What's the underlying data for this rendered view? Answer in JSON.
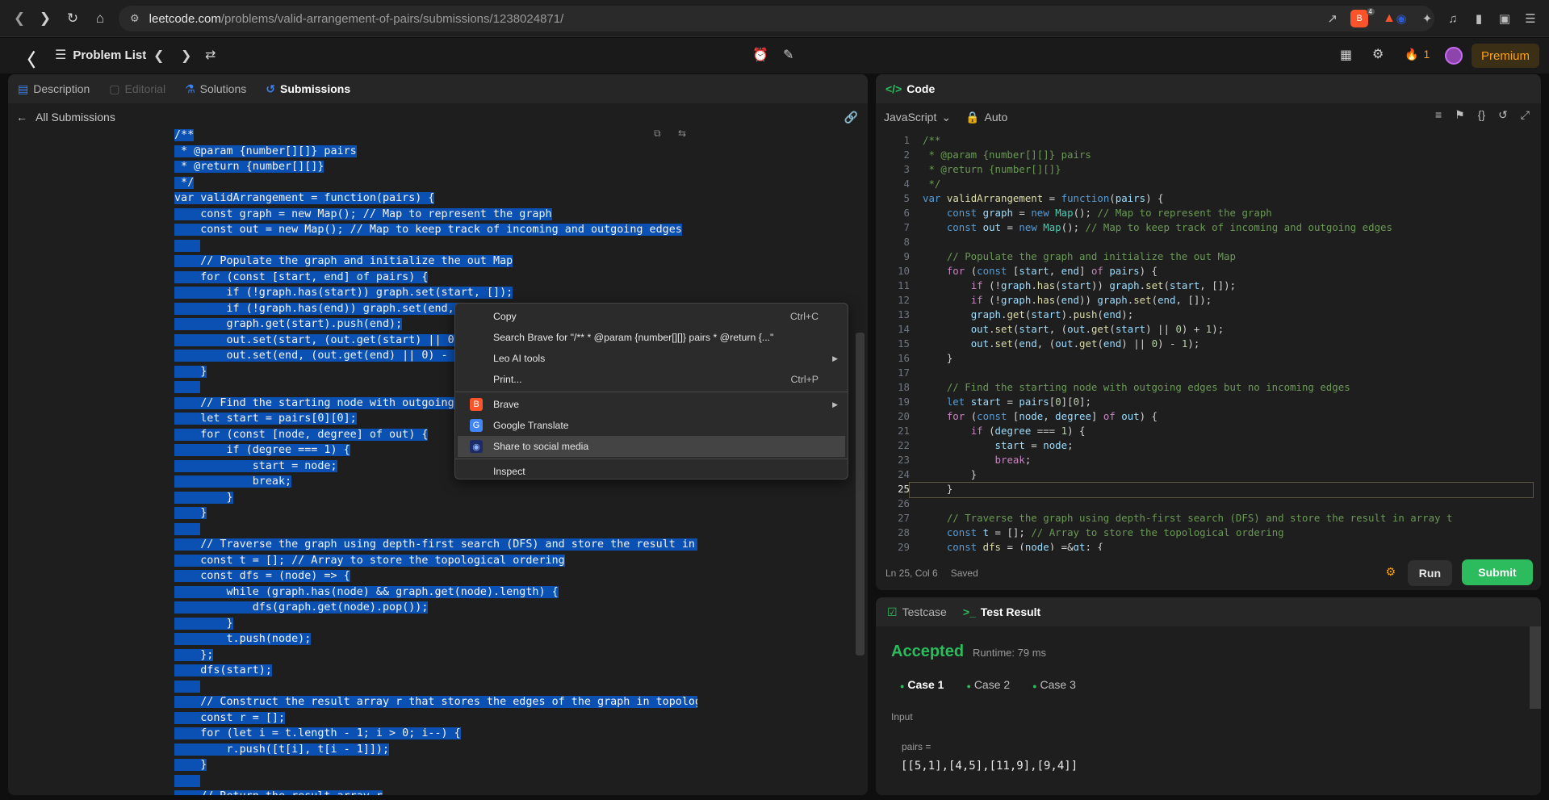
{
  "browser": {
    "url_host": "leetcode.com",
    "url_path": "/problems/valid-arrangement-of-pairs/submissions/1238024871/",
    "brave_badge": "4"
  },
  "topbar": {
    "problem_list": "Problem List",
    "streak": "1",
    "premium": "Premium"
  },
  "left_tabs": {
    "description": "Description",
    "editorial": "Editorial",
    "solutions": "Solutions",
    "submissions": "Submissions"
  },
  "all_submissions": "All Submissions",
  "submission_code": [
    "/**",
    " * @param {number[][]} pairs",
    " * @return {number[][]}",
    " */",
    "var validArrangement = function(pairs) {",
    "    const graph = new Map(); // Map to represent the graph",
    "    const out = new Map(); // Map to keep track of incoming and outgoing edges",
    "",
    "    // Populate the graph and initialize the out Map",
    "    for (const [start, end] of pairs) {",
    "        if (!graph.has(start)) graph.set(start, []);",
    "        if (!graph.has(end)) graph.set(end, []);",
    "        graph.get(start).push(end);",
    "        out.set(start, (out.get(start) || 0) + 1);",
    "        out.set(end, (out.get(end) || 0) - 1);",
    "    }",
    "",
    "    // Find the starting node with outgoing edges but no incoming edges",
    "    let start = pairs[0][0];",
    "    for (const [node, degree] of out) {",
    "        if (degree === 1) {",
    "            start = node;",
    "            break;",
    "        }",
    "    }",
    "",
    "    // Traverse the graph using depth-first search (DFS) and store the result in array t",
    "    const t = []; // Array to store the topological ordering",
    "    const dfs = (node) => {",
    "        while (graph.has(node) && graph.get(node).length) {",
    "            dfs(graph.get(node).pop());",
    "        }",
    "        t.push(node);",
    "    };",
    "    dfs(start);",
    "",
    "    // Construct the result array r that stores the edges of the graph in topological order",
    "    const r = [];",
    "    for (let i = t.length - 1; i > 0; i--) {",
    "        r.push([t[i], t[i - 1]]);",
    "    }",
    "",
    "    // Return the result array r"
  ],
  "context_menu": {
    "copy": "Copy",
    "copy_shortcut": "Ctrl+C",
    "search": "Search Brave for \"/**  * @param {number[][]} pairs  * @return {...\"",
    "leo": "Leo AI tools",
    "print": "Print...",
    "print_shortcut": "Ctrl+P",
    "brave": "Brave",
    "translate": "Google Translate",
    "share": "Share to social media",
    "inspect": "Inspect"
  },
  "code_panel": {
    "title": "Code",
    "language": "JavaScript",
    "auto": "Auto",
    "status_pos": "Ln 25, Col 6",
    "status_saved": "Saved",
    "run": "Run",
    "submit": "Submit"
  },
  "test_panel": {
    "testcase_tab": "Testcase",
    "result_tab": "Test Result",
    "verdict": "Accepted",
    "runtime": "Runtime: 79 ms",
    "cases": [
      "Case 1",
      "Case 2",
      "Case 3"
    ],
    "input_label": "Input",
    "param_name": "pairs =",
    "param_value": "[[5,1],[4,5],[11,9],[9,4]]"
  },
  "colors": {
    "accent_green": "#2cbb5d",
    "premium": "#ffa116",
    "selection": "#0a51b3"
  }
}
